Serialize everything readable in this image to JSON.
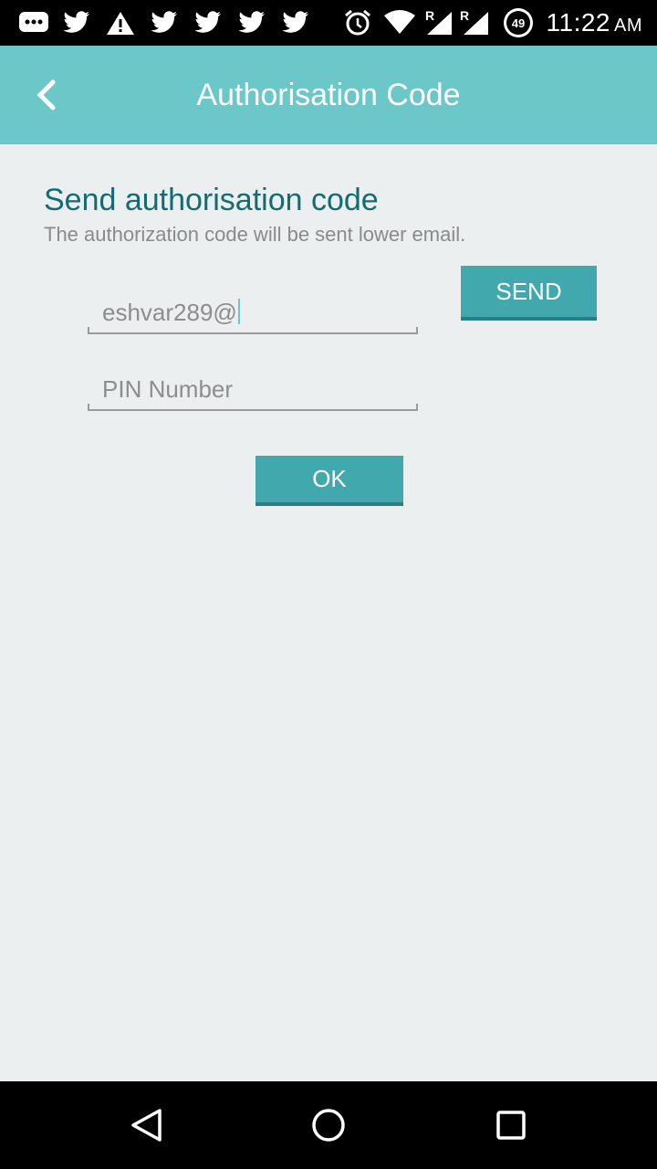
{
  "status_bar": {
    "time": "11:22",
    "ampm": "AM",
    "battery_level": "49",
    "network_indicator_1": "R",
    "network_indicator_2": "R"
  },
  "app_bar": {
    "title": "Authorisation Code"
  },
  "content": {
    "heading": "Send authorisation code",
    "subtitle": "The authorization code will be sent lower email.",
    "email_value": "eshvar289@",
    "pin_placeholder": "PIN Number",
    "send_label": "SEND",
    "ok_label": "OK"
  },
  "colors": {
    "app_bar": "#6cc7c9",
    "accent": "#41a9ad",
    "heading": "#156c70",
    "background": "#ebeff0"
  }
}
